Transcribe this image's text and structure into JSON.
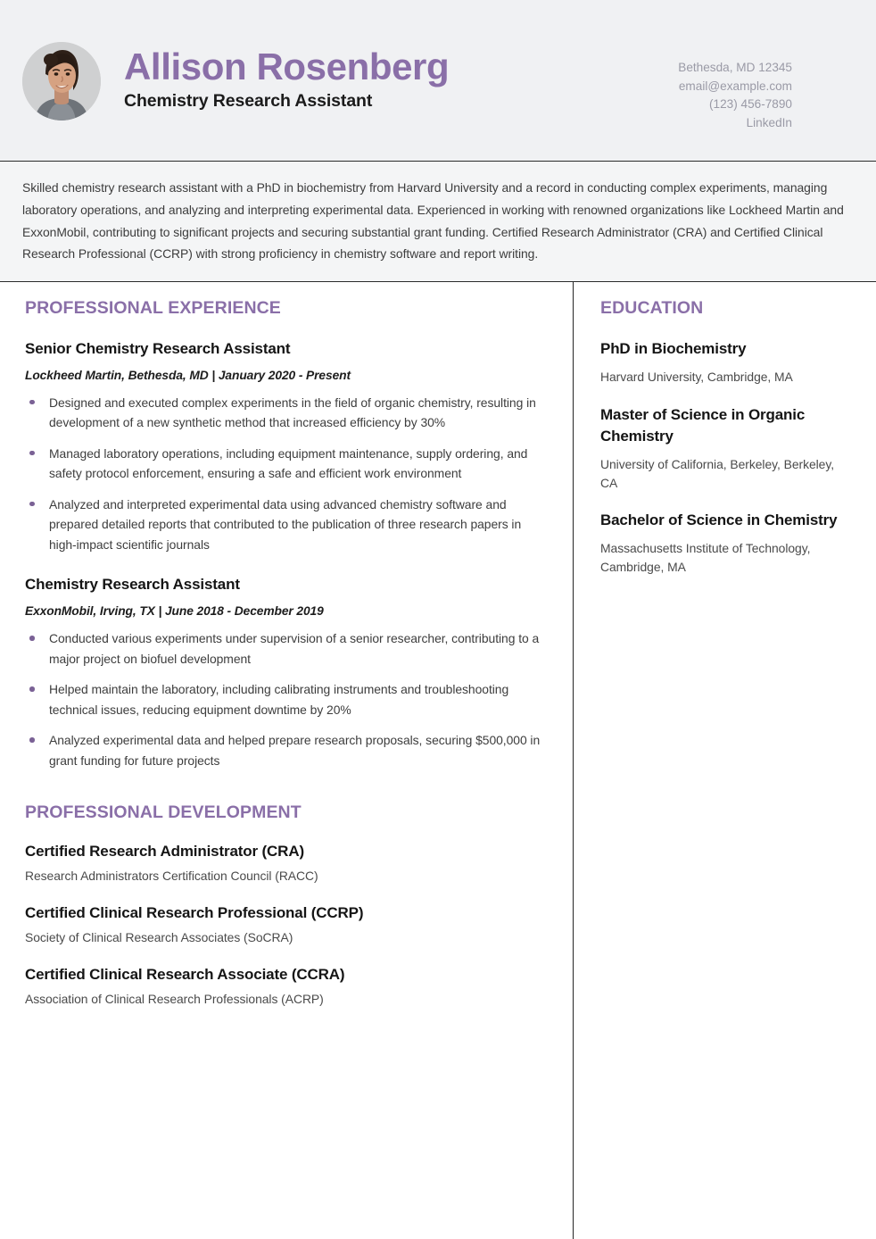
{
  "theme": {
    "accent": "#8a6fa8",
    "bullet": "#7a6195",
    "header_bg": "#f0f1f3",
    "summary_bg": "#f4f5f6",
    "rule": "#2b2b2b",
    "text": "#3d3d3d",
    "muted": "#9a9aa6"
  },
  "header": {
    "name": "Allison Rosenberg",
    "role": "Chemistry Research Assistant",
    "avatar_alt": "profile-photo",
    "contact": {
      "location": "Bethesda, MD 12345",
      "email": "email@example.com",
      "phone": "(123) 456-7890",
      "linkedin": "LinkedIn"
    }
  },
  "summary": {
    "text": "Skilled chemistry research assistant with a PhD in biochemistry from Harvard University and a record in conducting complex experiments, managing laboratory operations, and analyzing and interpreting experimental data. Experienced in working with renowned organizations like Lockheed Martin and ExxonMobil, contributing to significant projects and securing substantial grant funding. Certified Research Administrator (CRA) and Certified Clinical Research Professional (CCRP) with strong proficiency in chemistry software and report writing."
  },
  "experience": {
    "title": "PROFESSIONAL EXPERIENCE",
    "entries": [
      {
        "title": "Senior Chemistry Research Assistant",
        "meta": "Lockheed Martin, Bethesda, MD | January 2020 - Present",
        "bullets": [
          "Designed and executed complex experiments in the field of organic chemistry, resulting in development of a new synthetic method that increased efficiency by 30%",
          "Managed laboratory operations, including equipment maintenance, supply ordering, and safety protocol enforcement, ensuring a safe and efficient work environment",
          "Analyzed and interpreted experimental data using advanced chemistry software and prepared detailed reports that contributed to the publication of three research papers in high-impact scientific journals"
        ]
      },
      {
        "title": "Chemistry Research Assistant",
        "meta": "ExxonMobil, Irving, TX | June 2018 - December 2019",
        "bullets": [
          "Conducted various experiments under supervision of a senior researcher, contributing to a major project on biofuel development",
          "Helped maintain the laboratory, including calibrating instruments and troubleshooting technical issues, reducing equipment downtime by 20%",
          "Analyzed experimental data and helped prepare research proposals, securing $500,000 in grant funding for future projects"
        ]
      }
    ]
  },
  "development": {
    "title": "PROFESSIONAL DEVELOPMENT",
    "entries": [
      {
        "title": "Certified Research Administrator (CRA)",
        "org": "Research Administrators Certification Council (RACC)"
      },
      {
        "title": "Certified Clinical Research Professional (CCRP)",
        "org": "Society of Clinical Research Associates (SoCRA)"
      },
      {
        "title": "Certified Clinical Research Associate (CCRA)",
        "org": "Association of Clinical Research Professionals (ACRP)"
      }
    ]
  },
  "education": {
    "title": "EDUCATION",
    "entries": [
      {
        "degree": "PhD in Biochemistry",
        "school": "Harvard University, Cambridge, MA"
      },
      {
        "degree": "Master of Science in Organic Chemistry",
        "school": "University of California, Berkeley, Berkeley, CA"
      },
      {
        "degree": "Bachelor of Science in Chemistry",
        "school": "Massachusetts Institute of Technology, Cambridge, MA"
      }
    ]
  }
}
